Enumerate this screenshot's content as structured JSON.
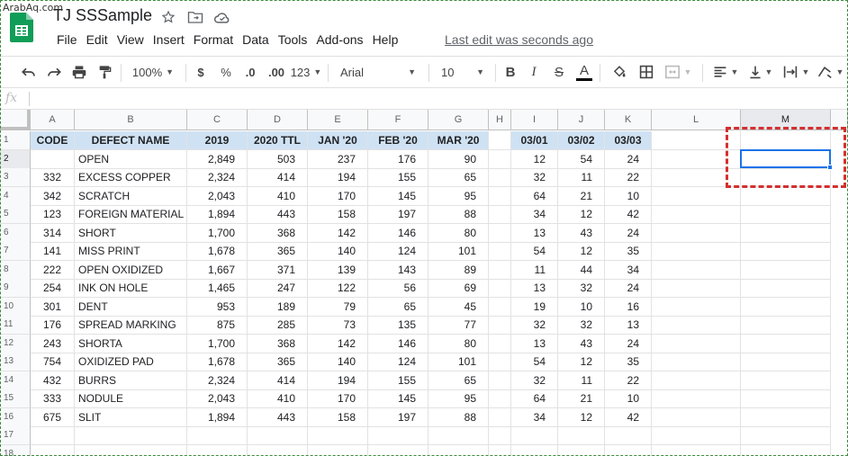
{
  "watermark": "ArabAq.com",
  "app": {
    "title": "TJ SSSample",
    "last_edit": "Last edit was seconds ago",
    "menu": [
      "File",
      "Edit",
      "View",
      "Insert",
      "Format",
      "Data",
      "Tools",
      "Add-ons",
      "Help"
    ]
  },
  "toolbar": {
    "zoom": "100%",
    "currency": "$",
    "percent": "%",
    "dec_decrease": ".0",
    "dec_increase": ".00",
    "more_formats": "123",
    "font": "Arial",
    "font_size": "10",
    "bold": "B",
    "italic": "I",
    "strike": "S",
    "text_color": "A"
  },
  "formula_bar": {
    "fx": "fx",
    "value": ""
  },
  "columns": [
    "A",
    "B",
    "C",
    "D",
    "E",
    "F",
    "G",
    "H",
    "I",
    "J",
    "K",
    "L",
    "M"
  ],
  "rows": [
    "1",
    "2",
    "3",
    "4",
    "5",
    "6",
    "7",
    "8",
    "9",
    "10",
    "11",
    "12",
    "13",
    "14",
    "15",
    "16",
    "17",
    "18"
  ],
  "headers": {
    "A": "CODE",
    "B": "DEFECT NAME",
    "C": "2019",
    "D": "2020 TTL",
    "E": "JAN '20",
    "F": "FEB '20",
    "G": "MAR '20",
    "I": "03/01",
    "J": "03/02",
    "K": "03/03"
  },
  "table": [
    [
      "",
      "OPEN",
      "2,849",
      "503",
      "237",
      "176",
      "90",
      "",
      "12",
      "54",
      "24"
    ],
    [
      "332",
      "EXCESS COPPER",
      "2,324",
      "414",
      "194",
      "155",
      "65",
      "",
      "32",
      "11",
      "22"
    ],
    [
      "342",
      "SCRATCH",
      "2,043",
      "410",
      "170",
      "145",
      "95",
      "",
      "64",
      "21",
      "10"
    ],
    [
      "123",
      "FOREIGN MATERIAL",
      "1,894",
      "443",
      "158",
      "197",
      "88",
      "",
      "34",
      "12",
      "42"
    ],
    [
      "314",
      "SHORT",
      "1,700",
      "368",
      "142",
      "146",
      "80",
      "",
      "13",
      "43",
      "24"
    ],
    [
      "141",
      "MISS PRINT",
      "1,678",
      "365",
      "140",
      "124",
      "101",
      "",
      "54",
      "12",
      "35"
    ],
    [
      "222",
      "OPEN OXIDIZED",
      "1,667",
      "371",
      "139",
      "143",
      "89",
      "",
      "11",
      "44",
      "34"
    ],
    [
      "254",
      "INK ON HOLE",
      "1,465",
      "247",
      "122",
      "56",
      "69",
      "",
      "13",
      "32",
      "24"
    ],
    [
      "301",
      "DENT",
      "953",
      "189",
      "79",
      "65",
      "45",
      "",
      "19",
      "10",
      "16"
    ],
    [
      "176",
      "SPREAD MARKING",
      "875",
      "285",
      "73",
      "135",
      "77",
      "",
      "32",
      "32",
      "13"
    ],
    [
      "243",
      "SHORTA",
      "1,700",
      "368",
      "142",
      "146",
      "80",
      "",
      "13",
      "43",
      "24"
    ],
    [
      "754",
      "OXIDIZED PAD",
      "1,678",
      "365",
      "140",
      "124",
      "101",
      "",
      "54",
      "12",
      "35"
    ],
    [
      "432",
      "BURRS",
      "2,324",
      "414",
      "194",
      "155",
      "65",
      "",
      "32",
      "11",
      "22"
    ],
    [
      "333",
      "NODULE",
      "2,043",
      "410",
      "170",
      "145",
      "95",
      "",
      "64",
      "21",
      "10"
    ],
    [
      "675",
      "SLIT",
      "1,894",
      "443",
      "158",
      "197",
      "88",
      "",
      "34",
      "12",
      "42"
    ]
  ],
  "selected_cell": "M2",
  "colors": {
    "header_fill": "#cfe2f3",
    "selection": "#1a73e8",
    "annotation": "#d32f2f",
    "sheets_green": "#0f9d58"
  }
}
